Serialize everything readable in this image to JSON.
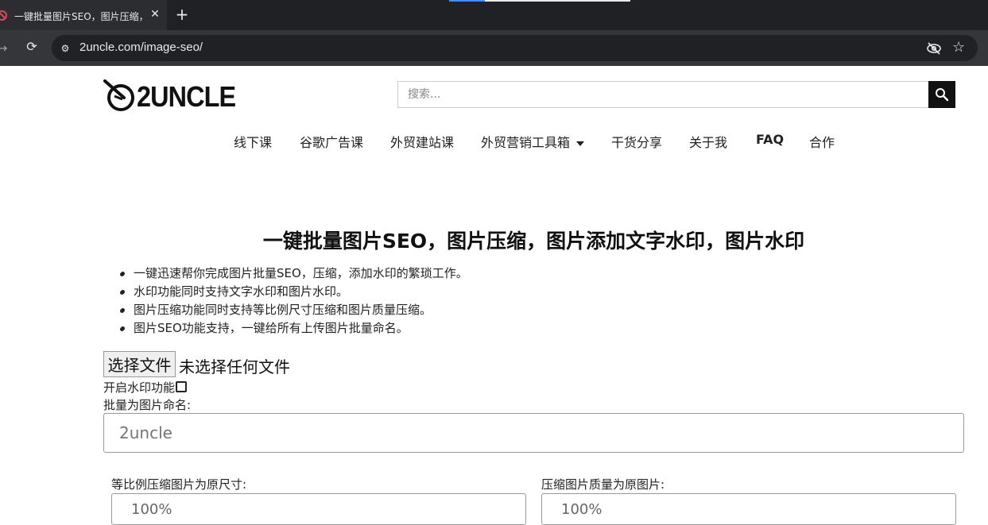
{
  "browser": {
    "tab_title": "一键批量图片SEO，图片压缩，",
    "tab_close": "✕",
    "new_tab": "+",
    "url": "2uncle.com/image-seo/",
    "loading_progress": 0.2
  },
  "header": {
    "logo_text": "2UNCLE",
    "search_placeholder": "搜索..."
  },
  "nav": {
    "items": [
      {
        "label": "线下课"
      },
      {
        "label": "谷歌广告课"
      },
      {
        "label": "外贸建站课"
      },
      {
        "label": "外贸营销工具箱"
      },
      {
        "label": "干货分享"
      },
      {
        "label": "关于我"
      },
      {
        "label": "FAQ"
      },
      {
        "label": "合作"
      }
    ]
  },
  "main": {
    "title": "一键批量图片SEO，图片压缩，图片添加文字水印，图片水印",
    "bullets": [
      "一键迅速帮你完成图片批量SEO，压缩，添加水印的繁琐工作。",
      "水印功能同时支持文字水印和图片水印。",
      "图片压缩功能同时支持等比例尺寸压缩和图片质量压缩。",
      "图片SEO功能支持，一键给所有上传图片批量命名。"
    ],
    "file_button": "选择文件",
    "file_status": "未选择任何文件",
    "watermark_label": "开启水印功能",
    "watermark_checked": false,
    "rename_label": "批量为图片命名:",
    "rename_placeholder": "2uncle",
    "resize_label": "等比例压缩图片为原尺寸:",
    "resize_value": "100%",
    "quality_label": "压缩图片质量为原图片:",
    "quality_value": "100%"
  },
  "colors": {
    "tabbar": "#202124",
    "toolbar": "#35363a",
    "search_button": "#111111",
    "favicon": "#e0465e"
  }
}
